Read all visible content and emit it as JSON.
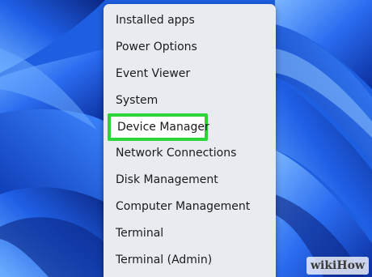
{
  "desktop": {
    "wallpaper": "windows-11-bloom-wallpaper",
    "colors": {
      "base": "#1d5fe0",
      "dark": "#0a2a8c",
      "light": "#5fa2ff"
    }
  },
  "menu": {
    "items": [
      {
        "label": "Installed apps",
        "icon": "none"
      },
      {
        "label": "Power Options",
        "icon": "none"
      },
      {
        "label": "Event Viewer",
        "icon": "none"
      },
      {
        "label": "System",
        "icon": "none"
      },
      {
        "label": "Device Manager",
        "icon": "none",
        "highlighted": true
      },
      {
        "label": "Network Connections",
        "icon": "none"
      },
      {
        "label": "Disk Management",
        "icon": "none"
      },
      {
        "label": "Computer Management",
        "icon": "none"
      },
      {
        "label": "Terminal",
        "icon": "none"
      },
      {
        "label": "Terminal (Admin)",
        "icon": "none"
      }
    ],
    "highlight_color": "#2bd53a"
  },
  "watermark": {
    "text": "wikiHow"
  }
}
